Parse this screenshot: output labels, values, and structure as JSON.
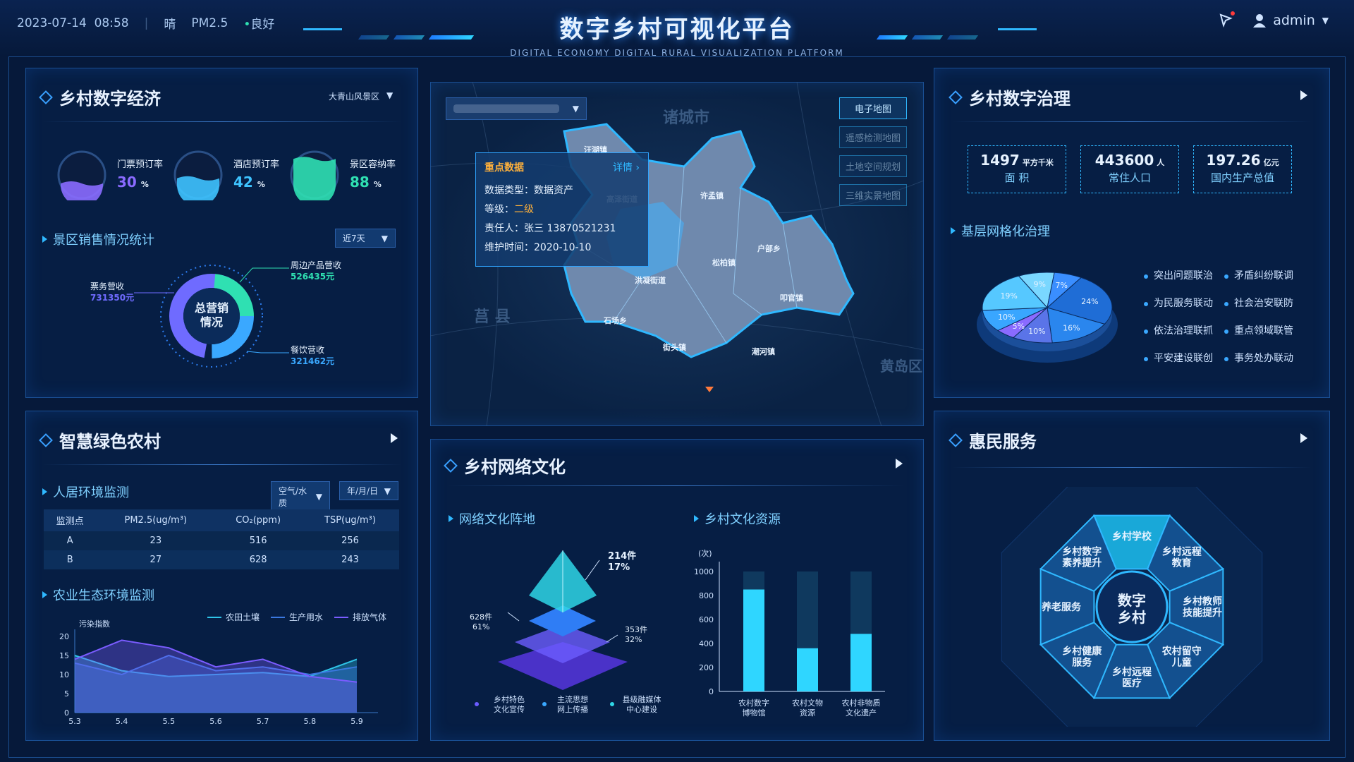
{
  "header": {
    "date": "2023-07-14",
    "time": "08:58",
    "weather": "晴",
    "pm_label": "PM2.5",
    "pm_value": "良好",
    "title": "数字乡村可视化平台",
    "subtitle": "DIGITAL ECONOMY DIGITAL RURAL VISUALIZATION PLATFORM",
    "user": "admin"
  },
  "economy": {
    "title": "乡村数字经济",
    "area_select": "大青山风景区",
    "rates": [
      {
        "label": "门票预订率",
        "value": "30",
        "unit": "%",
        "color": "#8a6bff"
      },
      {
        "label": "酒店预订率",
        "value": "42",
        "unit": "%",
        "color": "#3ec3ff"
      },
      {
        "label": "景区容纳率",
        "value": "88",
        "unit": "%",
        "color": "#2fe0b2"
      }
    ],
    "sales_title": "景区销售情况统计",
    "sales_range": "近7天",
    "donut_center": "总营销\n情况",
    "donut_items": [
      {
        "label": "票务营收",
        "value": "731350元",
        "color": "#6f6bff"
      },
      {
        "label": "周边产品营收",
        "value": "526435元",
        "color": "#2fe0b2"
      },
      {
        "label": "餐饮营收",
        "value": "321462元",
        "color": "#3aa8ff"
      }
    ]
  },
  "map": {
    "select_value": "",
    "buttons": [
      "电子地图",
      "遥感检测地图",
      "土地空间规划",
      "三维实景地图"
    ],
    "bg_labels": [
      "诸城市",
      "莒 县",
      "黄岛区"
    ],
    "towns": [
      "许孟镇",
      "洪凝街道",
      "松柏镇",
      "户部乡",
      "叩官镇",
      "石场乡",
      "街头镇",
      "潮河镇",
      "汪湖镇",
      "高泽街道"
    ],
    "tooltip": {
      "title": "重点数据",
      "detail": "详情 ›",
      "rows": [
        {
          "k": "数据类型：",
          "v": "数据资产"
        },
        {
          "k": "等级：",
          "v": "二级"
        },
        {
          "k": "责任人：",
          "v": "张三   13870521231"
        },
        {
          "k": "维护时间：",
          "v": "2020-10-10"
        }
      ]
    }
  },
  "governance": {
    "title": "乡村数字治理",
    "stats": [
      {
        "num": "1497",
        "unit": "平方千米",
        "label": "面 积"
      },
      {
        "num": "443600",
        "unit": "人",
        "label": "常住人口"
      },
      {
        "num": "197.26",
        "unit": "亿元",
        "label": "国内生产总值"
      }
    ],
    "grid_title": "基层网格化治理",
    "legend": [
      "突出问题联治",
      "矛盾纠纷联调",
      "为民服务联动",
      "社会治安联防",
      "依法治理联抓",
      "重点领域联管",
      "平安建设联创",
      "事务处办联动"
    ]
  },
  "green": {
    "title": "智慧绿色农村",
    "env_title": "人居环境监测",
    "select1": "空气/水质",
    "select2": "年/月/日",
    "table_headers": [
      "监测点",
      "PM2.5(ug/m³)",
      "CO₂(ppm)",
      "TSP(ug/m³)"
    ],
    "table_rows": [
      [
        "A",
        "23",
        "516",
        "256"
      ],
      [
        "B",
        "27",
        "628",
        "243"
      ]
    ],
    "eco_title": "农业生态环境监测",
    "legend": [
      "农田土壤",
      "生产用水",
      "排放气体"
    ]
  },
  "culture": {
    "title": "乡村网络文化",
    "front_title": "网络文化阵地",
    "pyramid_labels": [
      {
        "n": "214件",
        "p": "17%"
      },
      {
        "n": "628件",
        "p": "61%"
      },
      {
        "n": "353件",
        "p": "32%"
      }
    ],
    "pyramid_legend": [
      "乡村特色\n文化宣传",
      "主流思想\n网上传播",
      "县级融媒体\n中心建设"
    ],
    "res_title": "乡村文化资源",
    "y_unit": "(次)"
  },
  "service": {
    "title": "惠民服务",
    "center": "数字\n乡村",
    "segments": [
      "乡村学校",
      "乡村远程教育",
      "乡村教师技能提升",
      "农村留守儿童",
      "乡村远程医疗",
      "乡村健康服务",
      "养老服务",
      "乡村数字素养提升"
    ]
  },
  "chart_data": [
    {
      "type": "pie",
      "title": "基层网格化治理",
      "values": [
        24,
        16,
        10,
        5,
        10,
        19,
        9,
        7
      ],
      "labels": [
        "24%",
        "16%",
        "10%",
        "5%",
        "10%",
        "19%",
        "9%",
        "7%"
      ],
      "colors": [
        "#1f6dd6",
        "#2a86ee",
        "#5a74e8",
        "#8a6bff",
        "#39a6ff",
        "#56c8ff",
        "#7ad7ff",
        "#3a8eff"
      ]
    },
    {
      "type": "area",
      "title": "农业生态环境监测",
      "ylabel": "污染指数",
      "ylim": [
        0,
        20
      ],
      "yticks": [
        0,
        5,
        10,
        15,
        20
      ],
      "x": [
        "5.3",
        "5.4",
        "5.5",
        "5.6",
        "5.7",
        "5.8",
        "5.9"
      ],
      "series": [
        {
          "name": "农田土壤",
          "values": [
            15,
            11,
            9.5,
            10,
            10.5,
            9.5,
            14
          ],
          "color": "#2fc4e8"
        },
        {
          "name": "生产用水",
          "values": [
            13,
            10,
            15,
            11,
            12,
            10,
            12
          ],
          "color": "#3a78e0"
        },
        {
          "name": "排放气体",
          "values": [
            14,
            19,
            17,
            12,
            14,
            9.5,
            8
          ],
          "color": "#7a5cff"
        }
      ]
    },
    {
      "type": "bar",
      "title": "乡村文化资源",
      "categories": [
        "农村数字\n博物馆",
        "农村文物\n资源",
        "农村非物质\n文化遗产"
      ],
      "values": [
        850,
        360,
        480
      ],
      "ylim": [
        0,
        1000
      ],
      "yticks": [
        0,
        200,
        400,
        600,
        800,
        1000
      ]
    }
  ]
}
